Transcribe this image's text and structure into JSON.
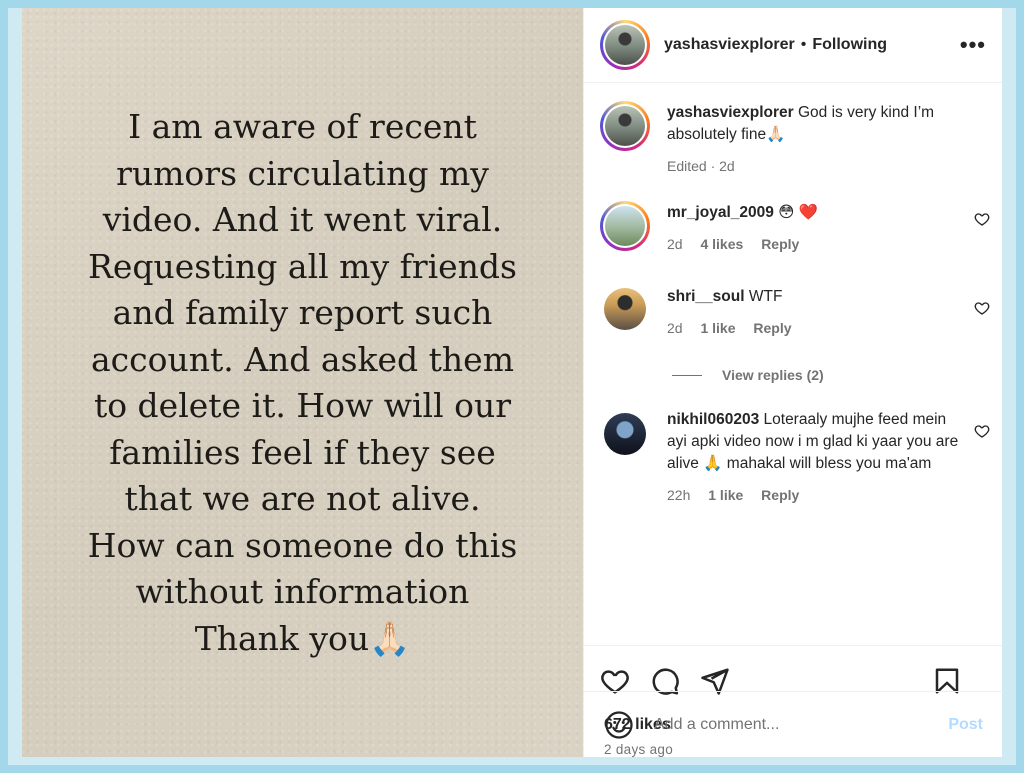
{
  "media": {
    "text": "I am aware of recent\nrumors circulating my\nvideo. And it went viral.\nRequesting all my friends\nand family report such\naccount. And asked them\nto delete it. How will our\nfamilies feel if they see\nthat we are not alive.\nHow can someone do this\nwithout information\nThank you🙏🏻"
  },
  "header": {
    "username": "yashasviexplorer",
    "separator": "•",
    "following": "Following",
    "more_icon": "•••"
  },
  "caption": {
    "username": "yashasviexplorer",
    "text": "God is very kind I’m absolutely fine🙏🏻",
    "meta": "Edited · 2d"
  },
  "comments": [
    {
      "username": "mr_joyal_2009",
      "text": "😳 ❤️",
      "time": "2d",
      "likes": "4 likes",
      "reply": "Reply"
    },
    {
      "username": "shri__soul",
      "text": "WTF",
      "time": "2d",
      "likes": "1 like",
      "reply": "Reply"
    },
    {
      "username": "nikhil060203",
      "text": "Loteraaly mujhe feed mein ayi apki video now i m glad ki yaar you are alive 🙏 mahakal will bless you ma'am",
      "time": "22h",
      "likes": "1 like",
      "reply": "Reply"
    }
  ],
  "view_replies": "View replies (2)",
  "actions": {
    "likes": "672 likes",
    "ago": "2 days ago"
  },
  "add_comment": {
    "placeholder": "Add a comment...",
    "post_label": "Post"
  }
}
